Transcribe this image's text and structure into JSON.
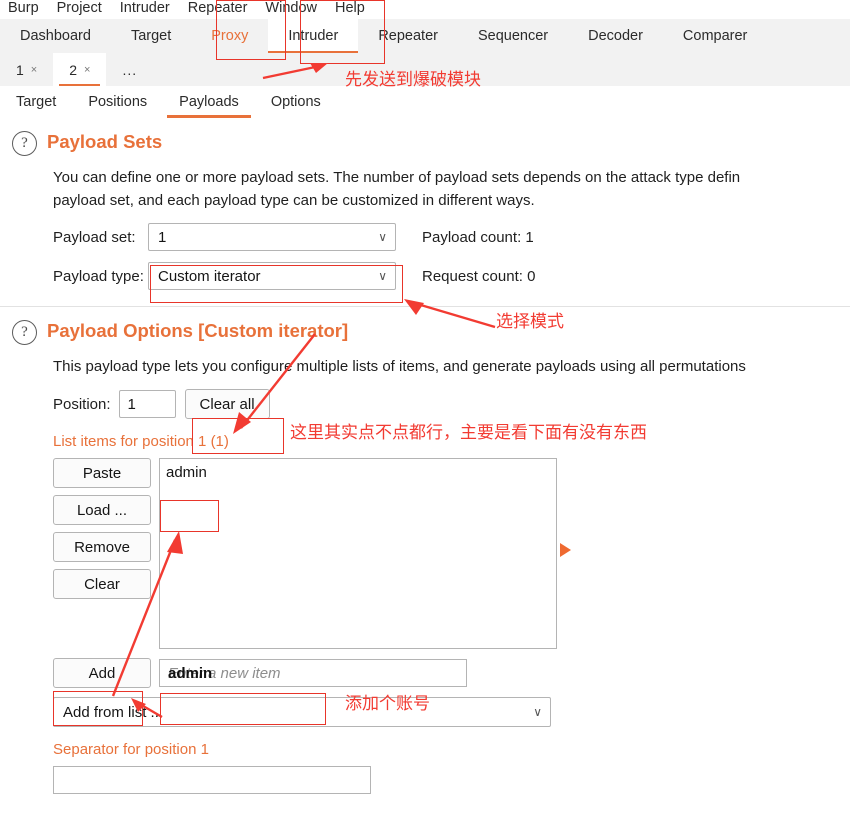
{
  "menubar": {
    "items": [
      {
        "label": "Burp"
      },
      {
        "label": "Project"
      },
      {
        "label": "Intruder"
      },
      {
        "label": "Repeater"
      },
      {
        "label": "Window"
      },
      {
        "label": "Help"
      }
    ]
  },
  "main_tabs": [
    {
      "label": "Dashboard",
      "state": "normal"
    },
    {
      "label": "Target",
      "state": "normal"
    },
    {
      "label": "Proxy",
      "state": "accent"
    },
    {
      "label": "Intruder",
      "state": "active"
    },
    {
      "label": "Repeater",
      "state": "normal"
    },
    {
      "label": "Sequencer",
      "state": "normal"
    },
    {
      "label": "Decoder",
      "state": "normal"
    },
    {
      "label": "Comparer",
      "state": "normal"
    }
  ],
  "attack_tabs": {
    "tabs": [
      {
        "label": "1",
        "close": "×",
        "active": false
      },
      {
        "label": "2",
        "close": "×",
        "active": true
      }
    ],
    "more": "..."
  },
  "sub_tabs": [
    {
      "label": "Target",
      "active": false
    },
    {
      "label": "Positions",
      "active": false
    },
    {
      "label": "Payloads",
      "active": true
    },
    {
      "label": "Options",
      "active": false
    }
  ],
  "payload_sets": {
    "help_icon": "question-mark-icon",
    "title": "Payload Sets",
    "desc_line1": "You can define one or more payload sets. The number of payload sets depends on the attack type defin",
    "desc_line2": "payload set, and each payload type can be customized in different ways.",
    "payload_set_label": "Payload set:",
    "payload_set_value": "1",
    "payload_type_label": "Payload type:",
    "payload_type_value": "Custom iterator",
    "payload_count": "Payload count: 1",
    "request_count": "Request count: 0",
    "chevron": "∨"
  },
  "payload_options": {
    "help_icon": "question-mark-icon",
    "title": "Payload Options [Custom iterator]",
    "desc": "This payload type lets you configure multiple lists of items, and generate payloads using all permutations",
    "position_label": "Position:",
    "position_value": "1",
    "clear_all_label": "Clear all",
    "list_heading": "List items for position 1 (1)",
    "side_buttons": [
      {
        "label": "Paste"
      },
      {
        "label": "Load ..."
      },
      {
        "label": "Remove"
      },
      {
        "label": "Clear"
      }
    ],
    "list_items": [
      "admin"
    ],
    "add_button_label": "Add",
    "add_input_placeholder": "Enter a new item",
    "add_input_value": "admin",
    "add_from_list_label": "Add from list ...",
    "add_from_list_chevron": "∨",
    "separator_heading": "Separator for position 1",
    "separator_value": ""
  },
  "annotations": [
    {
      "id": "note-send-to-intruder",
      "text": "先发送到爆破模块"
    },
    {
      "id": "note-select-mode",
      "text": "选择模式"
    },
    {
      "id": "note-clear-all",
      "text": "这里其实点不点都行，主要是看下面有没有东西"
    },
    {
      "id": "note-add-account",
      "text": "添加个账号"
    }
  ],
  "colors": {
    "accent": "#e8713a",
    "annotation": "#f23b32",
    "tab_active_underline": "#e8713a"
  }
}
